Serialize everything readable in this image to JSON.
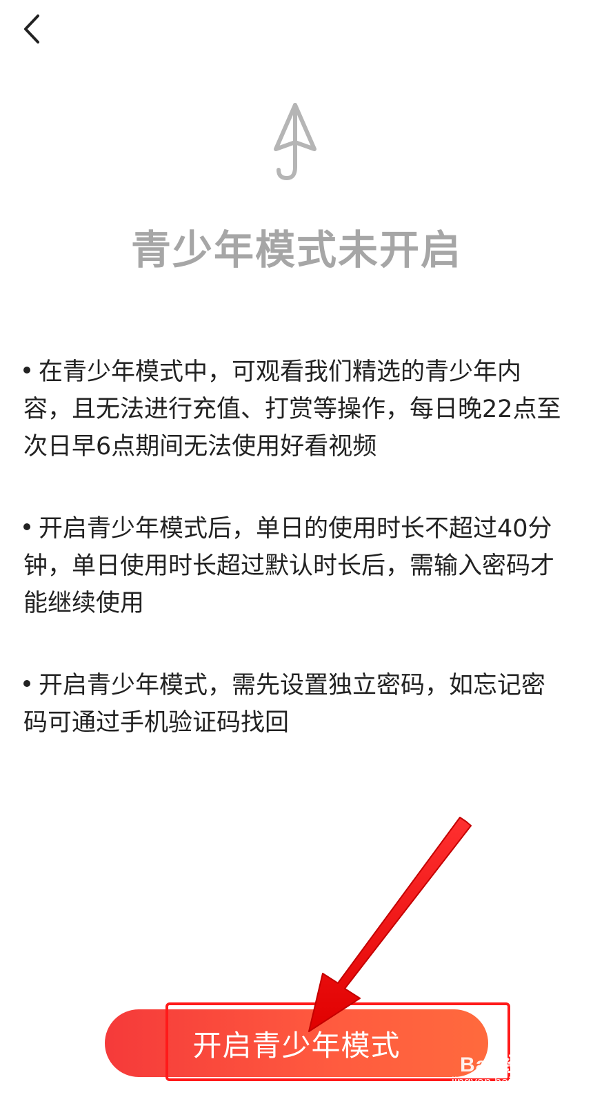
{
  "header": {
    "back_icon": "chevron-left-icon"
  },
  "hero": {
    "icon": "umbrella-icon",
    "title": "青少年模式未开启"
  },
  "rules": [
    "在青少年模式中，可观看我们精选的青少年内容，且无法进行充值、打赏等操作，每日晚22点至次日早6点期间无法使用好看视频",
    "开启青少年模式后，单日的使用时长不超过40分钟，单日使用时长超过默认时长后，需输入密码才能继续使用",
    "开启青少年模式，需先设置独立密码，如忘记密码可通过手机验证码找回"
  ],
  "cta": {
    "label": "开启青少年模式"
  },
  "watermark": {
    "logo": "Bai 经验",
    "sub": "jingyan.baidu.com"
  },
  "colors": {
    "accent": "#f53a3a",
    "title_gray": "#a6a6a6",
    "annotation_red": "#ff1a1a"
  }
}
